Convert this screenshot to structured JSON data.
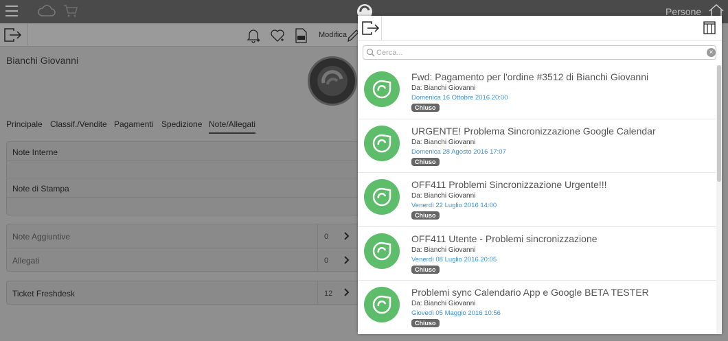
{
  "topbar": {
    "right_label": "Persone",
    "icons": [
      "menu-icon",
      "cloud-icon",
      "cart-icon",
      "app-logo-icon",
      "home-icon"
    ]
  },
  "toolbar": {
    "edit_label": "Modifica",
    "icons": [
      "exit-icon",
      "bell-icon",
      "heart-icon",
      "pdf-icon",
      "pencil-icon"
    ]
  },
  "contact": {
    "name": "Bianchi Giovanni"
  },
  "tabs": [
    {
      "label": "Principale"
    },
    {
      "label": "Classif./Vendite"
    },
    {
      "label": "Pagamenti"
    },
    {
      "label": "Spedizione"
    },
    {
      "label": "Note/Allegati",
      "active": true
    }
  ],
  "notes": {
    "internal_label": "Note Interne",
    "print_label": "Note di Stampa"
  },
  "extras": [
    {
      "label": "Note Aggiuntive",
      "count": "0"
    },
    {
      "label": "Allegati",
      "count": "0"
    }
  ],
  "freshdesk": {
    "label": "Ticket Freshdesk",
    "count": "12"
  },
  "panel": {
    "search_placeholder": "Cerca...",
    "tickets": [
      {
        "title": "Fwd: Pagamento per l'ordine #3512 di  Bianchi Giovanni",
        "from": "Da:  Bianchi Giovanni",
        "date": "Domenica 16 Ottobre 2016 20:00",
        "status": "Chiuso"
      },
      {
        "title": "URGENTE! Problema Sincronizzazione Google Calendar",
        "from": "Da:  Bianchi Giovanni",
        "date": "Domenica 28 Agosto 2016 17:07",
        "status": "Chiuso"
      },
      {
        "title": "OFF411 Problemi Sincronizzazione Urgente!!!",
        "from": "Da:  Bianchi Giovanni",
        "date": "Venerdì 22 Luglio 2016 14:00",
        "status": "Chiuso"
      },
      {
        "title": "OFF411 Utente - Problemi sincronizzazione",
        "from": "Da:  Bianchi Giovanni",
        "date": "Venerdì 08 Luglio 2016 20:05",
        "status": "Chiuso"
      },
      {
        "title": "Problemi sync Calendario App e Google BETA TESTER",
        "from": "Da:  Bianchi Giovanni",
        "date": "Giovedì 05 Maggio 2016 10:56",
        "status": "Chiuso"
      }
    ]
  },
  "colors": {
    "ticket_icon": "#5ebd6a",
    "date_text": "#3d93d6",
    "badge": "#666666",
    "topbar": "#4a4a4a"
  }
}
